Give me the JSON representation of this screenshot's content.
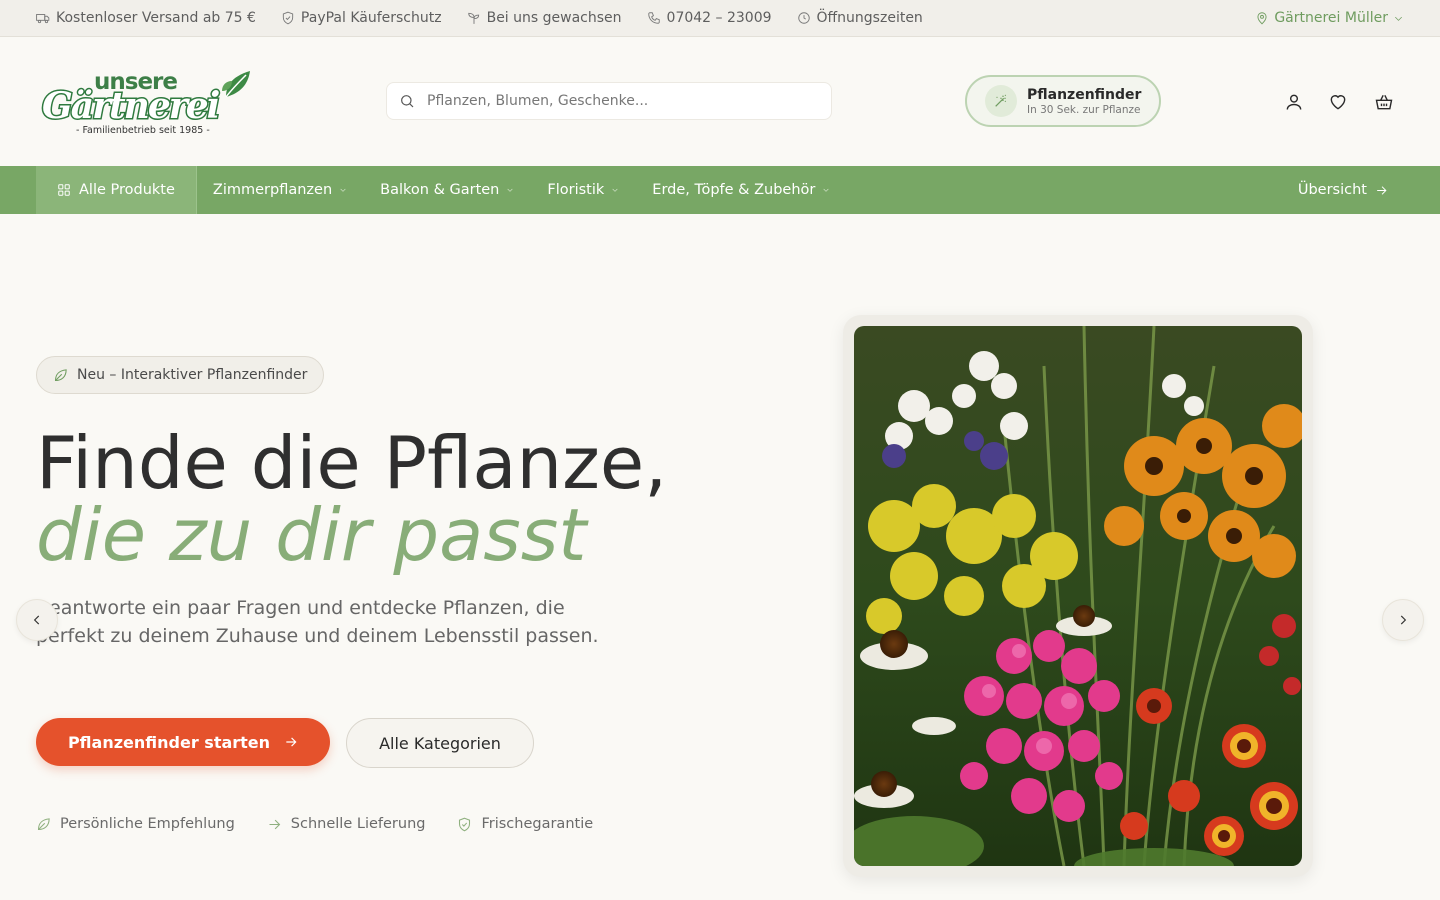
{
  "topbar": {
    "items": [
      {
        "icon": "truck-icon",
        "label": "Kostenloser Versand ab 75 €"
      },
      {
        "icon": "shield-check-icon",
        "label": "PayPal Käuferschutz"
      },
      {
        "icon": "sprout-icon",
        "label": "Bei uns gewachsen"
      },
      {
        "icon": "phone-icon",
        "label": "07042 – 23009"
      },
      {
        "icon": "clock-icon",
        "label": "Öffnungszeiten"
      }
    ],
    "store": "Gärtnerei Müller"
  },
  "logo": {
    "line1": "unsere",
    "line2": "Gärtnerei",
    "tagline": "- Familienbetrieb seit 1985 -"
  },
  "search": {
    "placeholder": "Pflanzen, Blumen, Geschenke..."
  },
  "finder": {
    "title": "Pflanzenfinder",
    "subtitle": "In 30 Sek. zur Pflanze"
  },
  "nav": {
    "all": "Alle Produkte",
    "items": [
      "Zimmerpflanzen",
      "Balkon & Garten",
      "Floristik",
      "Erde, Töpfe & Zubehör"
    ],
    "overview": "Übersicht"
  },
  "hero": {
    "badge": "Neu – Interaktiver Pflanzenfinder",
    "title_line1": "Finde die Pflanze,",
    "title_line2": "die zu dir passt",
    "lead": "Beantworte ein paar Fragen und entdecke Pflanzen, die perfekt zu deinem Zuhause und deinem Lebensstil passen.",
    "cta_primary": "Pflanzenfinder starten",
    "cta_secondary": "Alle Kategorien",
    "usps": [
      "Persönliche Empfehlung",
      "Schnelle Lieferung",
      "Frischegarantie"
    ]
  },
  "colors": {
    "accent_green": "#78a765",
    "cta_orange": "#e5522c",
    "title_green": "#88ad78"
  }
}
